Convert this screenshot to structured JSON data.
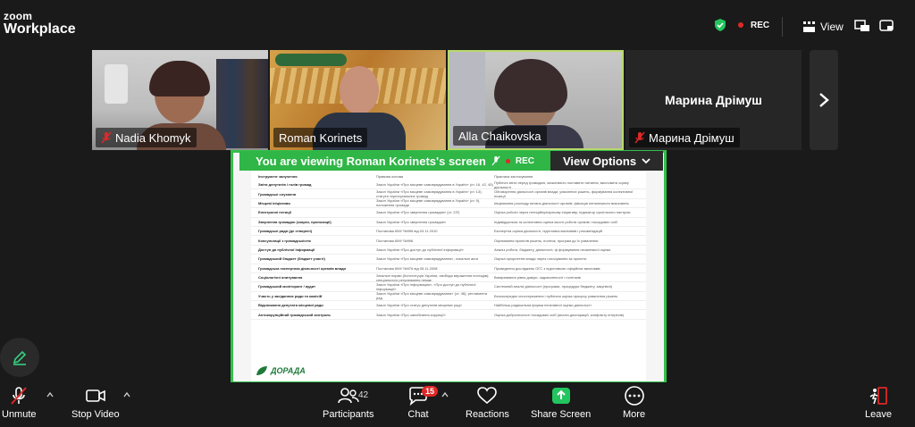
{
  "app": {
    "brand_line1": "zoom",
    "brand_line2": "Workplace"
  },
  "topbar": {
    "rec_label": "REC",
    "view_label": "View"
  },
  "participants_strip": [
    {
      "name": "Nadia Khomyk",
      "muted": true
    },
    {
      "name": "Roman Korinets",
      "muted": false
    },
    {
      "name": "Alla Chaikovska",
      "muted": false
    },
    {
      "name": "Марина Дрімуш",
      "muted": true,
      "video_off": true
    }
  ],
  "share": {
    "viewing_text": "You are viewing  Roman Korinets's screen",
    "rec_label": "REC",
    "view_options_label": "View Options"
  },
  "document": {
    "headers": [
      "Інструмент залучення",
      "Правова основа",
      "Практика застосування"
    ],
    "rows": [
      [
        "Звіти депутатів і голів громад",
        "Закон України «Про місцеве самоврядування в Україні» (ст. 16, 42, 45)",
        "Публічні звіти перед громадою, можливість поставити питання, висловити оцінку діяльності"
      ],
      [
        "Громадські слухання",
        "Закон України «Про місцеве самоврядування в Україні» (ст. 13); статути територіальних громад",
        "Обговорення діяльності органів влади, ухвалених рішень, формування колективної позиції"
      ],
      [
        "Місцеві ініціативи",
        "Закон України «Про місцеве самоврядування в Україні» (ст. 9), положення громади",
        "Ініціювання розгляду питань діяльності органів; фіксація неналежного виконання"
      ],
      [
        "Електронні петиції",
        "Закон України «Про звернення громадян» (ст. 23¹)",
        "Оцінка роботи через петиційну/карткову ініціативу; індикатор суспільного настрою"
      ],
      [
        "Звернення громадян (скарги, пропозиції)",
        "Закон України «Про звернення громадян»",
        "Індивідуальна та колективна оцінка якості роботи органів і посадових осіб"
      ],
      [
        "Громадські ради (де створені)",
        "Постанова КМУ №996 від 03.11.2010",
        "Експертна оцінка діяльності, підготовка висновків і рекомендацій"
      ],
      [
        "Консультації з громадськістю",
        "Постанова КМУ №996",
        "Оцінювання проектів рішень, політик, програм до їх ухвалення"
      ],
      [
        "Доступ до публічної інформації",
        "Закон України «Про доступ до публічної інформації»",
        "Аналіз роботи, бюджету, діяльності; ф формування незалежної оцінки"
      ],
      [
        "Громадський бюджет (бюджет участі)",
        "Закон України «Про місцеве самоврядування», локальні акти",
        "Оцінка пріоритетів влади через голосування за проекти"
      ],
      [
        "Громадська експертиза діяльності органів влади",
        "Постанова КМУ №976 від 05.11.2008",
        "Проведення досліджень ОГС з підготовкою офіційних висновків"
      ],
      [
        "Соціологічні опитування",
        "Загальні норми (Конституція України, свобода вираження поглядів); спеціального регулювання немає",
        "Вимірювання рівня довіри, задоволеності і політиків"
      ],
      [
        "Громадський моніторинг / аудит",
        "Закон України «Про інформацію», «Про доступ до публічної інформації»",
        "Системний аналіз діяльності (програми, процедури бюджету, закупівлі)"
      ],
      [
        "Участь у засіданнях ради та комісій",
        "Закон України «Про місцеве самоврядування» (ст. 46); регламенти рад",
        "Безпосереднє спостереження і публічна оцінка процесу ухвалення рішень"
      ],
      [
        "Відкликання депутата місцевої ради",
        "Закон України «Про статус депутатів місцевих рад»",
        "Найбільш радикальна форма негативної оцінки діяльності"
      ],
      [
        "Антикорупційний громадський контроль",
        "Закон України «Про запобігання корупції»",
        "Оцінка доброчесності посадових осіб (аналіз декларацій, конфлікту інтересів)"
      ]
    ],
    "logo_text": "ДОРАДА"
  },
  "toolbar": {
    "unmute": "Unmute",
    "stop_video": "Stop Video",
    "participants": "Participants",
    "participants_count": "42",
    "chat": "Chat",
    "chat_badge": "15",
    "reactions": "Reactions",
    "share_screen": "Share Screen",
    "more": "More",
    "leave": "Leave"
  },
  "colors": {
    "accent_green": "#2fb646",
    "rec_red": "#e02828",
    "background": "#1a1a1a"
  }
}
